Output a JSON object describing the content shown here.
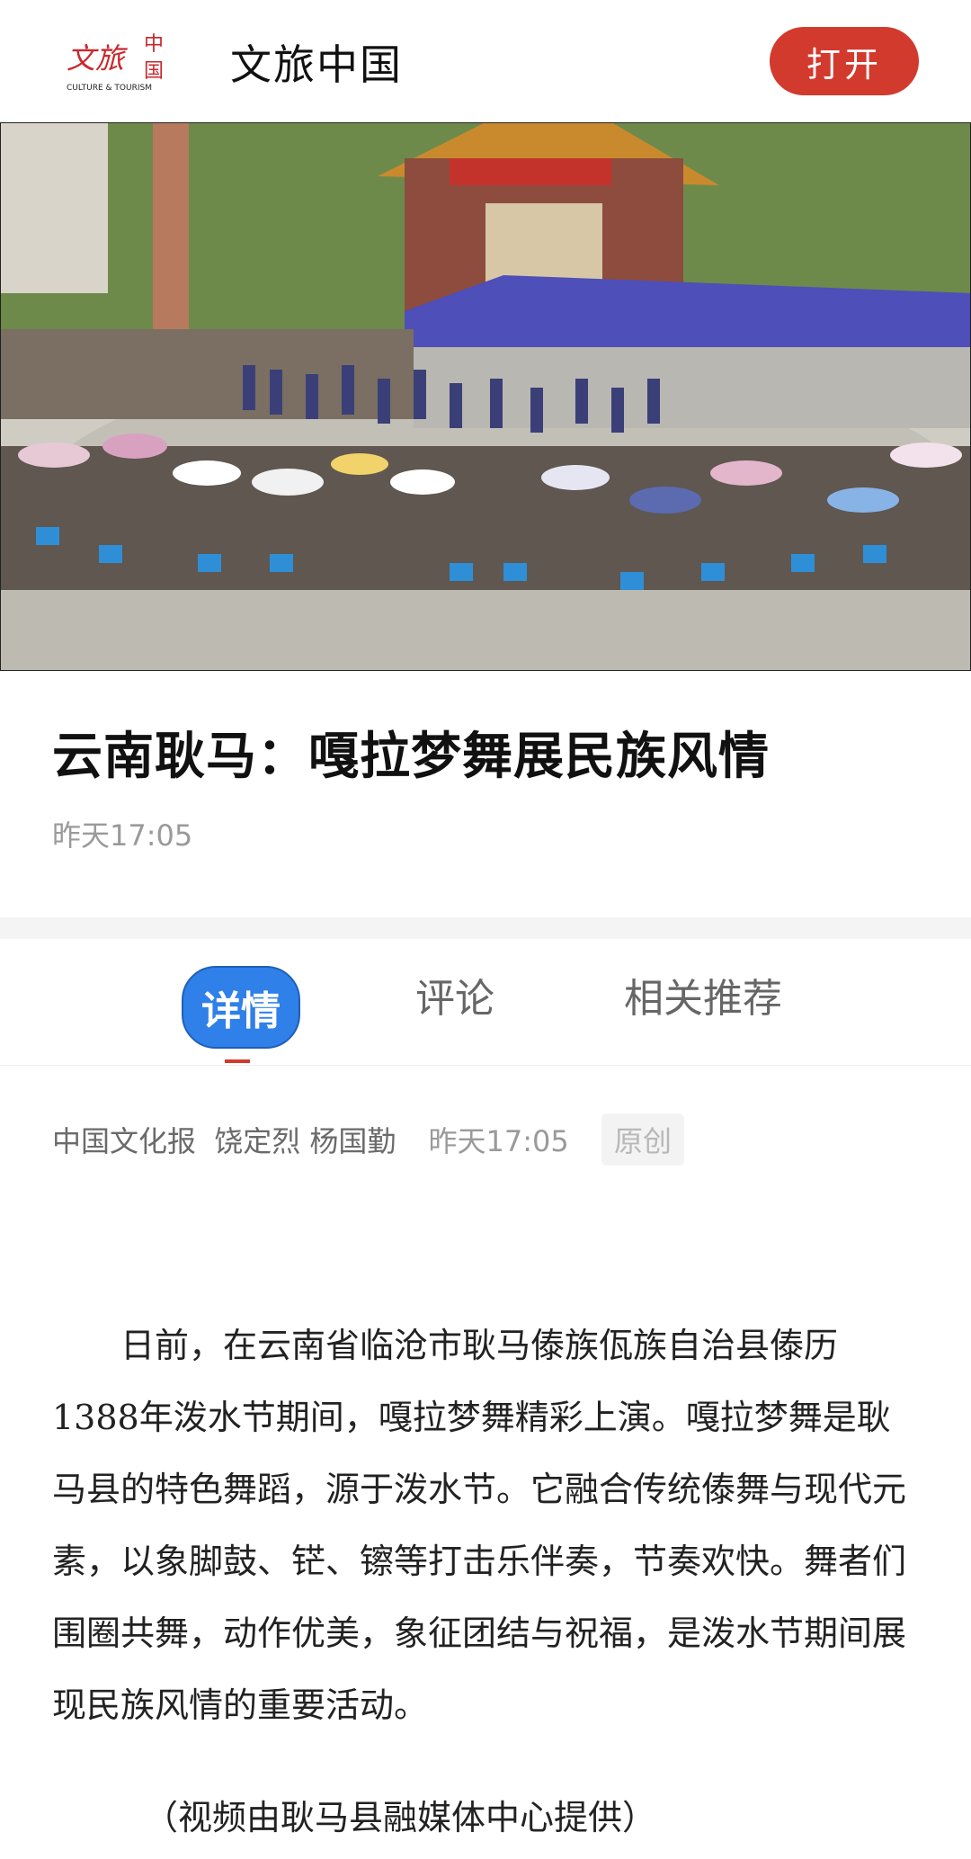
{
  "header": {
    "logo_text": "文旅中国",
    "logo_subtext": "CULTURE & TOURISM",
    "app_name": "文旅中国",
    "open_label": "打开"
  },
  "article": {
    "title": "云南耿马：嘎拉梦舞展民族风情",
    "time": "昨天17:05"
  },
  "tabs": [
    {
      "label": "详情"
    },
    {
      "label": "评论"
    },
    {
      "label": "相关推荐"
    }
  ],
  "meta": {
    "source": "中国文化报",
    "authors": "饶定烈 杨国勤",
    "time": "昨天17:05",
    "badge": "原创"
  },
  "body": {
    "paragraph": "日前，在云南省临沧市耿马傣族佤族自治县傣历1388年泼水节期间，嘎拉梦舞精彩上演。嘎拉梦舞是耿马县的特色舞蹈，源于泼水节。它融合传统傣舞与现代元素，以象脚鼓、铓、镲等打击乐伴奏，节奏欢快。舞者们围圈共舞，动作优美，象征团结与祝福，是泼水节期间展现民族风情的重要活动。",
    "credit": "（视频由耿马县融媒体中心提供）"
  },
  "colors": {
    "brand_red": "#d23a2e",
    "tab_active_blue": "#2f80e8"
  }
}
